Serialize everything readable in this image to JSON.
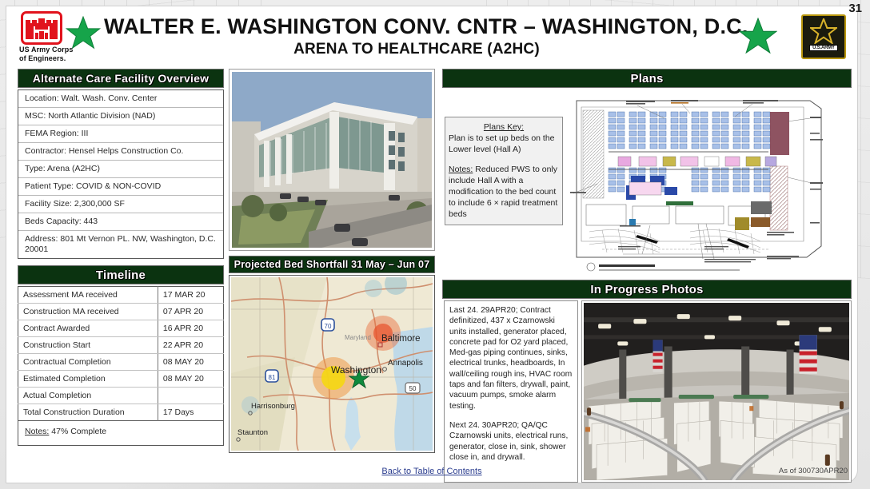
{
  "slide": {
    "number": "31",
    "title_main": "WALTER E. WASHINGTON CONV. CNTR – WASHINGTON, D.C.",
    "title_sub": "ARENA TO HEALTHCARE (A2HC)",
    "org_label_line1": "US Army Corps",
    "org_label_line2": "of Engineers.",
    "army_wordmark": "U.S.ARMY"
  },
  "overview": {
    "header": "Alternate Care Facility Overview",
    "rows": [
      "Location:  Walt. Wash. Conv.  Center",
      "MSC:  North Atlantic Division  (NAD)",
      "FEMA Region:  III",
      "Contractor: Hensel Helps Construction Co.",
      "Type: Arena (A2HC)",
      "Patient Type: COVID & NON-COVID",
      "Facility Size: 2,300,000  SF",
      "Beds Capacity: 443",
      "Address: 801 Mt Vernon PL. NW, Washington, D.C. 20001"
    ]
  },
  "timeline": {
    "header": "Timeline",
    "rows": [
      {
        "label": "Assessment MA received",
        "value": "17 MAR  20"
      },
      {
        "label": "Construction MA received",
        "value": "07 APR  20"
      },
      {
        "label": "Contract Awarded",
        "value": "16 APR  20"
      },
      {
        "label": "Construction Start",
        "value": "22 APR  20"
      },
      {
        "label": "Contractual Completion",
        "value": "08 MAY  20"
      },
      {
        "label": "Estimated Completion",
        "value": "08 MAY  20"
      },
      {
        "label": "Actual Completion",
        "value": ""
      },
      {
        "label": "Total Construction Duration",
        "value": "17 Days"
      }
    ],
    "notes_label": "Notes:",
    "notes_value": "47% Complete"
  },
  "shortfall": {
    "header": "Projected Bed Shortfall 31 May – Jun 07",
    "map_labels": {
      "state": "Maryland",
      "cities": [
        "Baltimore",
        "Annapolis",
        "Washington",
        "Harrisonburg",
        "Staunton"
      ],
      "routes": [
        "70",
        "81",
        "50"
      ]
    }
  },
  "plans": {
    "header": "Plans",
    "key_title": "Plans Key:",
    "key_body": "Plan is to set up  beds on the Lower level (Hall A)",
    "notes_label": "Notes:",
    "notes_body": "Reduced PWS to only include Hall A with a modification to the bed count to include 6 × rapid treatment beds"
  },
  "in_progress": {
    "header": "In Progress Photos",
    "last_24": "Last 24. 29APR20; Contract definitized, 437 x Czarnowski units installed, generator placed, concrete pad for O2 yard placed, Med-gas piping continues, sinks, electrical trunks, headboards, In wall/ceiling rough ins, HVAC room taps and fan filters, drywall, paint, vacuum pumps, smoke alarm testing.",
    "next_24": "Next 24. 30APR20; QA/QC Czarnowski units, electrical runs, generator, close in, sink, shower close in, and drywall."
  },
  "footer": {
    "toc_link": "Back to Table of Contents",
    "as_of": "As of 300730APR20"
  },
  "colors": {
    "panel_header_green": "#0b3310",
    "accent_green_star": "#16a44a",
    "castle_red": "#e1131d",
    "link_blue": "#2b3d8f"
  }
}
